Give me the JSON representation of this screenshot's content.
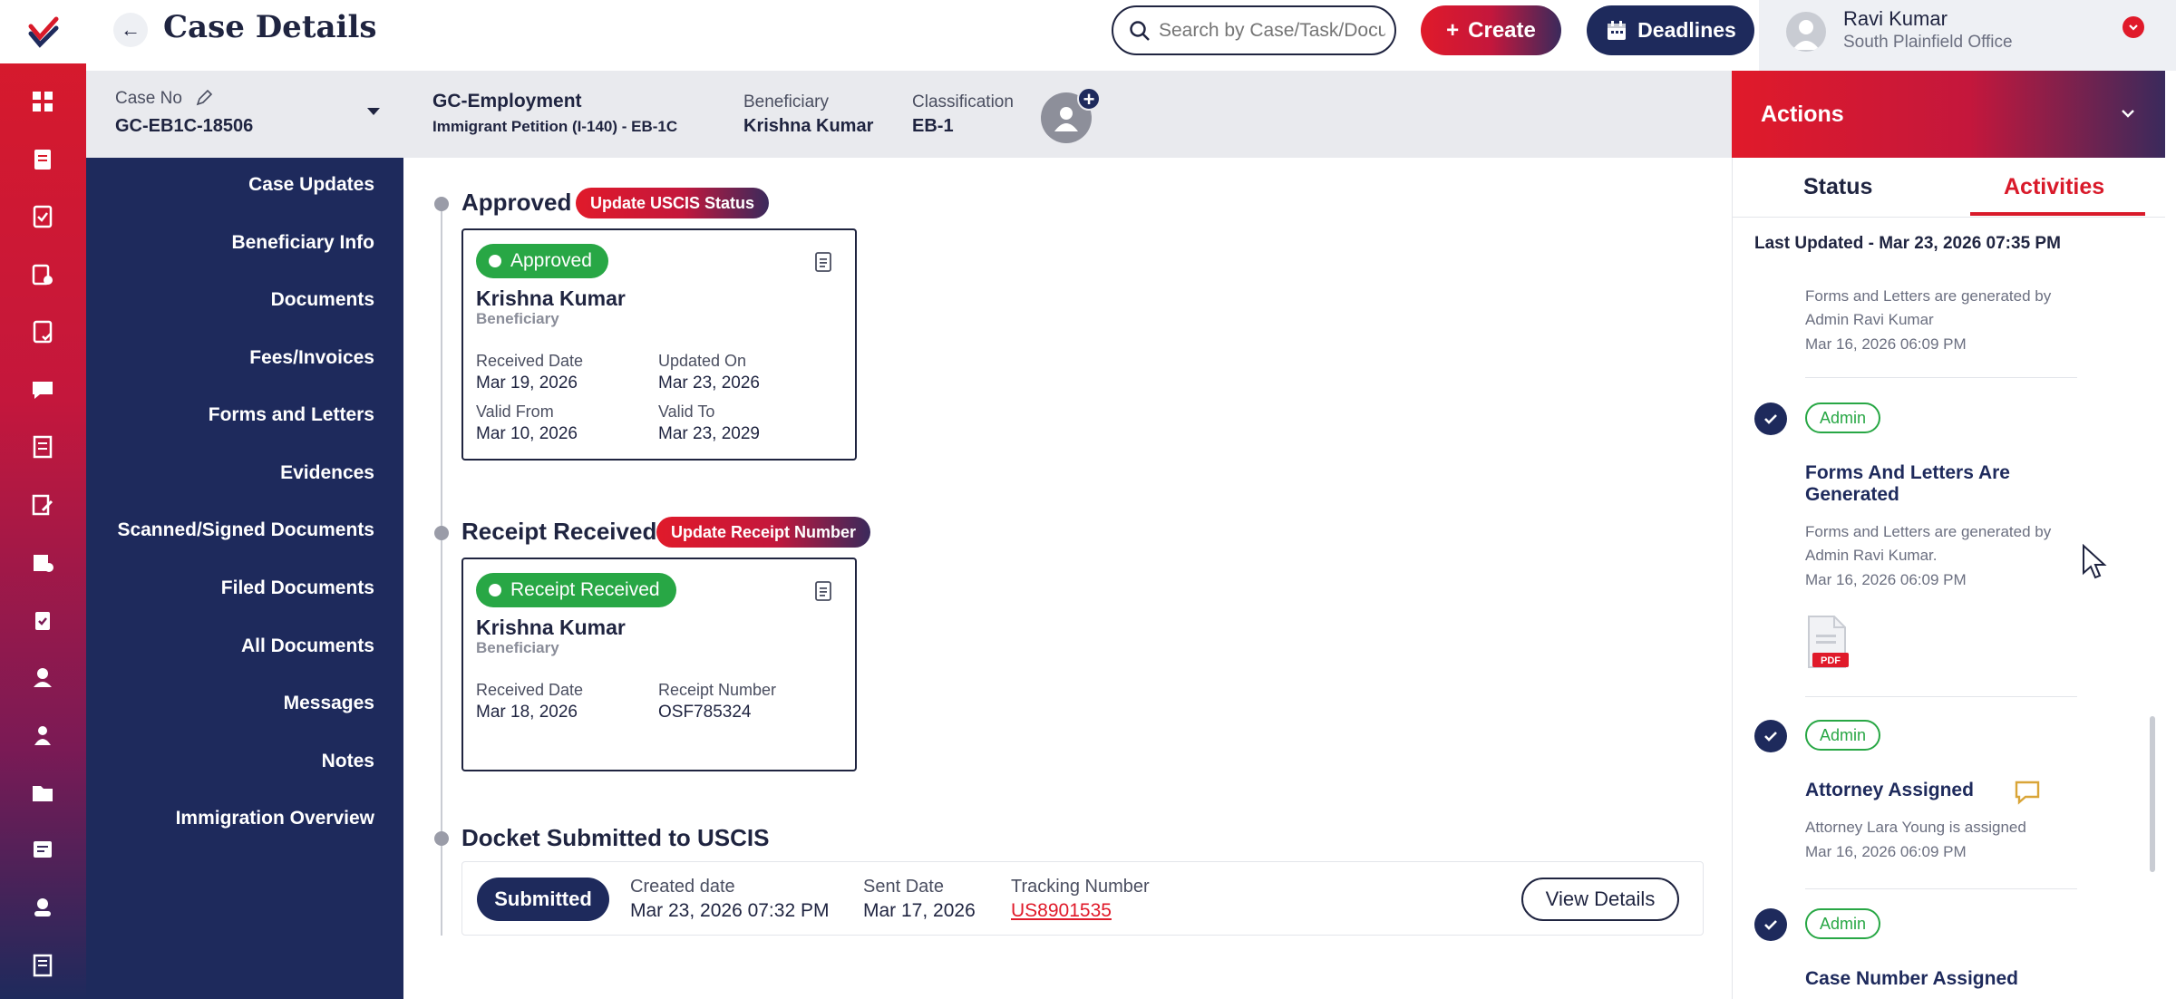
{
  "app": {
    "title": "Case Details"
  },
  "search": {
    "placeholder": "Search by Case/Task/Document"
  },
  "toolbar": {
    "create_label": "Create",
    "deadlines_label": "Deadlines"
  },
  "user": {
    "name": "Ravi Kumar",
    "office": "South Plainfield Office"
  },
  "case": {
    "case_no_label": "Case No",
    "case_no": "GC-EB1C-18506",
    "type_title": "GC-Employment",
    "type_sub": "Immigrant Petition (I-140) - EB-1C",
    "beneficiary_label": "Beneficiary",
    "beneficiary": "Krishna Kumar",
    "classification_label": "Classification",
    "classification": "EB-1"
  },
  "sidebar": {
    "items": [
      {
        "label": "Case Updates"
      },
      {
        "label": "Beneficiary Info"
      },
      {
        "label": "Documents"
      },
      {
        "label": "Fees/Invoices"
      },
      {
        "label": "Forms and Letters"
      },
      {
        "label": "Evidences"
      },
      {
        "label": "Scanned/Signed Documents"
      },
      {
        "label": "Filed Documents"
      },
      {
        "label": "All Documents"
      },
      {
        "label": "Messages"
      },
      {
        "label": "Notes"
      },
      {
        "label": "Immigration Overview"
      }
    ]
  },
  "rail_icons": [
    "dashboard-icon",
    "cases-icon",
    "tasks-icon",
    "forms-icon",
    "checklist-icon",
    "chat-icon",
    "notes-icon",
    "edit-icon",
    "clients-icon",
    "clipboard-icon",
    "user-icon",
    "users-icon",
    "folder-icon",
    "messages-icon",
    "contacts-icon",
    "book-icon"
  ],
  "timeline": {
    "approved": {
      "title": "Approved",
      "action": "Update USCIS Status",
      "status": "Approved",
      "name": "Krishna Kumar",
      "role": "Beneficiary",
      "received_label": "Received Date",
      "received": "Mar 19, 2026",
      "updated_label": "Updated On",
      "updated": "Mar 23, 2026",
      "valid_from_label": "Valid From",
      "valid_from": "Mar 10, 2026",
      "valid_to_label": "Valid To",
      "valid_to": "Mar 23, 2029"
    },
    "receipt": {
      "title": "Receipt Received",
      "action": "Update Receipt Number",
      "status": "Receipt Received",
      "name": "Krishna Kumar",
      "role": "Beneficiary",
      "received_label": "Received Date",
      "received": "Mar 18, 2026",
      "receipt_label": "Receipt Number",
      "receipt": "OSF785324"
    },
    "docket": {
      "title": "Docket Submitted to USCIS",
      "status": "Submitted",
      "created_label": "Created date",
      "created": "Mar 23, 2026 07:32 PM",
      "sent_label": "Sent Date",
      "sent": "Mar 17, 2026",
      "tracking_label": "Tracking Number",
      "tracking": "US8901535",
      "view_label": "View Details"
    }
  },
  "actions": {
    "title": "Actions",
    "tab_status": "Status",
    "tab_activities": "Activities",
    "last_updated": "Last Updated - Mar 23, 2026 07:35 PM",
    "activities": [
      {
        "text_1": "Forms and Letters are generated by",
        "text_2": "Admin Ravi Kumar",
        "date": "Mar 16, 2026 06:09 PM"
      },
      {
        "tag": "Admin",
        "title_1": "Forms And Letters Are",
        "title_2": "Generated",
        "text_1": "Forms and Letters are generated by",
        "text_2": "Admin Ravi Kumar.",
        "date": "Mar 16, 2026 06:09 PM",
        "file_label": "PDF"
      },
      {
        "tag": "Admin",
        "title": "Attorney Assigned",
        "text": "Attorney Lara Young is assigned",
        "date": "Mar 16, 2026 06:09 PM"
      },
      {
        "tag": "Admin",
        "title": "Case Number Assigned"
      }
    ]
  },
  "colors": {
    "brand_red": "#d91a2a",
    "navy": "#1e2a5c",
    "success": "#28a745"
  }
}
